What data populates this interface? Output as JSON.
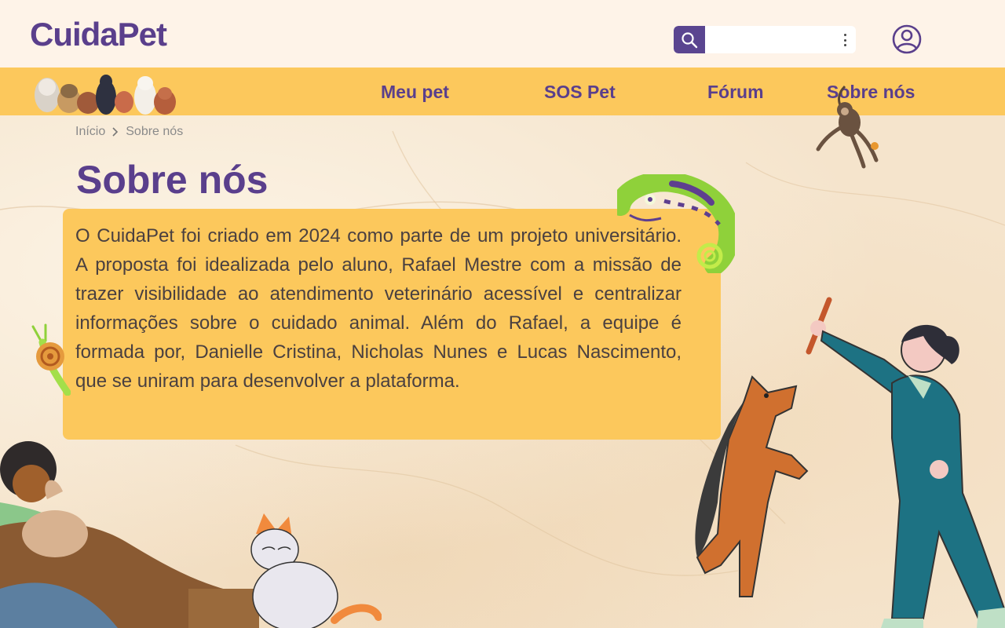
{
  "app": {
    "logo": "CuidaPet"
  },
  "search": {
    "placeholder": ""
  },
  "nav": {
    "items": [
      {
        "label": "Meu pet"
      },
      {
        "label": "SOS Pet"
      },
      {
        "label": "Fórum"
      },
      {
        "label": "Sobre nós"
      }
    ]
  },
  "breadcrumb": {
    "home": "Início",
    "current": "Sobre nós"
  },
  "page": {
    "title": "Sobre nós",
    "body": "O CuidaPet foi criado em 2024 como parte de um projeto universitário. A proposta foi idealizada pelo aluno, Rafael Mestre com a missão de trazer visibilidade ao atendimento veterinário acessível e centralizar informações sobre o cuidado animal. Além do Rafael, a equipe é formada por, Danielle Cristina, Nicholas Nunes e Lucas Nascimento, que se uniram para desenvolver a plataforma."
  },
  "colors": {
    "brand_purple": "#5a3f8c",
    "nav_yellow": "#fcc85c",
    "header_bg": "#fef3e8",
    "search_button": "#5a4590"
  },
  "icons": {
    "search": "search-icon",
    "menu": "kebab-menu-icon",
    "user": "user-account-icon"
  }
}
